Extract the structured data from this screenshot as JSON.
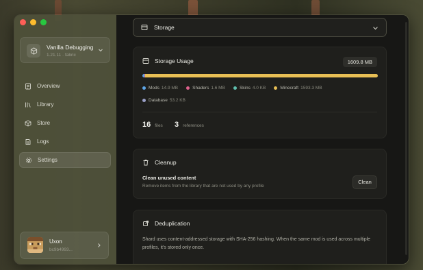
{
  "sidebar": {
    "profile": {
      "name": "Vanilla Debugging",
      "subtitle": "1.21.11 · fabric"
    },
    "nav": [
      {
        "label": "Overview",
        "icon": "overview-icon"
      },
      {
        "label": "Library",
        "icon": "library-icon"
      },
      {
        "label": "Store",
        "icon": "store-icon"
      },
      {
        "label": "Logs",
        "icon": "logs-icon"
      },
      {
        "label": "Settings",
        "icon": "gear-icon",
        "active": true
      }
    ],
    "user": {
      "name": "Uxon",
      "id": "bc9b4993..."
    }
  },
  "main": {
    "section_select": {
      "value": "Storage"
    },
    "storage_usage": {
      "title": "Storage Usage",
      "total": "1609.8 MB",
      "segments": [
        {
          "label": "Mods",
          "value": "14.9 MB",
          "mb": 14.9,
          "color": "#5ea6e8"
        },
        {
          "label": "Shaders",
          "value": "1.6 MB",
          "mb": 1.6,
          "color": "#e0628e"
        },
        {
          "label": "Skins",
          "value": "4.0 KB",
          "mb": 0.004,
          "color": "#5fbfae"
        },
        {
          "label": "Minecraft",
          "value": "1593.3 MB",
          "mb": 1593.3,
          "color": "#e8bf55"
        },
        {
          "label": "Database",
          "value": "53.2 KB",
          "mb": 0.052,
          "color": "#9aa0c8"
        }
      ],
      "files_count": "16",
      "files_label": "files",
      "references_count": "3",
      "references_label": "references"
    },
    "cleanup": {
      "title": "Cleanup",
      "item_title": "Clean unused content",
      "item_desc": "Remove items from the library that are not used by any profile",
      "button": "Clean"
    },
    "deduplication": {
      "title": "Deduplication",
      "text": "Shard uses content-addressed storage with SHA-256 hashing. When the same mod is used across multiple profiles, it's stored only once."
    }
  }
}
